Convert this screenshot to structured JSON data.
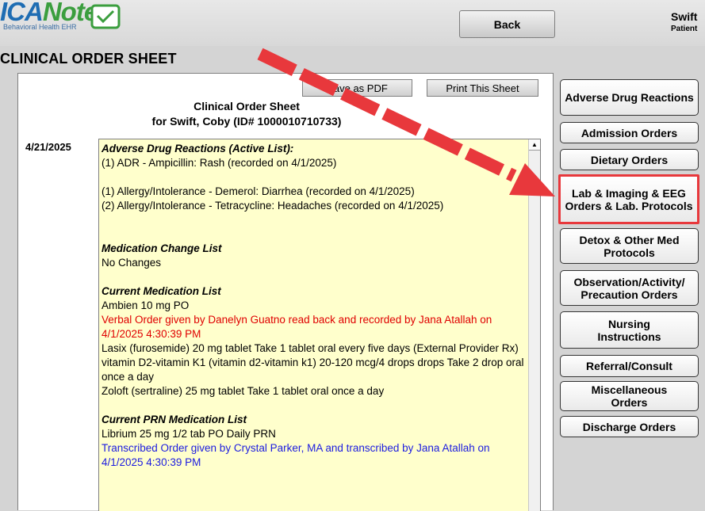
{
  "header": {
    "logo_text": "ICANotes",
    "logo_subtitle": "Behavioral Health EHR",
    "back_label": "Back",
    "patient_name": "Swift",
    "patient_sub": "Patient"
  },
  "page_title": "CLINICAL ORDER SHEET",
  "sheet": {
    "save_pdf_label": "Save as PDF",
    "print_label": "Print This Sheet",
    "title": "Clinical Order Sheet",
    "subtitle": "for Swift, Coby (ID# 1000010710733)",
    "date": "4/21/2025",
    "sections": {
      "adr_header": "Adverse Drug Reactions (Active List):",
      "adr_1": "(1) ADR - Ampicillin: Rash (recorded on 4/1/2025)",
      "allergy_1": "(1) Allergy/Intolerance - Demerol: Diarrhea (recorded on 4/1/2025)",
      "allergy_2": "(2) Allergy/Intolerance - Tetracycline: Headaches (recorded on 4/1/2025)",
      "med_change_header": "Medication Change List",
      "med_change_value": "No Changes",
      "current_med_header": "Current Medication List",
      "med_1": "Ambien 10 mg PO",
      "med_1_order": " Verbal Order given by Danelyn Guatno read back and recorded by Jana Atallah on 4/1/2025 4:30:39 PM",
      "med_2": "Lasix (furosemide) 20 mg tablet Take 1 tablet oral every five days      (External Provider Rx)",
      "med_3": "vitamin D2-vitamin K1 (vitamin d2-vitamin k1) 20-120 mcg/4 drops drops Take 2 drop oral once a day",
      "med_4": "Zoloft (sertraline) 25 mg tablet Take 1 tablet oral once a day",
      "prn_header": "Current PRN Medication List",
      "prn_1": "Librium 25 mg 1/2 tab PO Daily PRN",
      "prn_1_order": " Transcribed Order given by Crystal Parker, MA and transcribed by Jana Atallah on 4/1/2025 4:30:39 PM"
    }
  },
  "side_buttons": [
    {
      "label": "Adverse Drug Reactions"
    },
    {
      "label": "Admission Orders"
    },
    {
      "label": "Dietary Orders"
    },
    {
      "label": "Lab & Imaging & EEG Orders & Lab. Protocols"
    },
    {
      "label": "Detox & Other Med Protocols"
    },
    {
      "label": "Observation/Activity/ Precaution Orders"
    },
    {
      "label": "Nursing Instructions"
    },
    {
      "label": "Referral/Consult"
    },
    {
      "label": "Miscellaneous Orders"
    },
    {
      "label": "Discharge Orders"
    }
  ],
  "colors": {
    "highlight": "#e8383c",
    "content_bg": "#ffffcc",
    "verbal_order": "#e00000",
    "transcribed_order": "#1c1ce0"
  }
}
